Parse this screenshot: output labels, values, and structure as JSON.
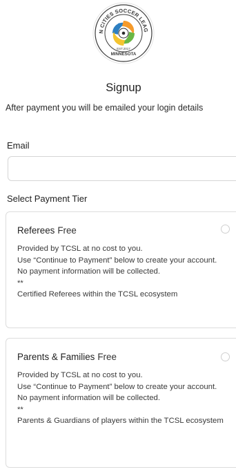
{
  "logo": {
    "arc_text": "TWIN CITIES SOCCER LEAGUES",
    "est": "EST.2017",
    "state": "MINNESOTA",
    "colors": {
      "ring": "#f2f2f2",
      "orange": "#f59a2b",
      "blue": "#2e7fc1",
      "green": "#6ab744",
      "yellow": "#f4c430"
    }
  },
  "form": {
    "title": "Signup",
    "subtitle": "After payment you will be emailed your login details",
    "email_label": "Email",
    "email_value": "",
    "email_placeholder": "",
    "tier_label": "Select Payment Tier"
  },
  "tiers": [
    {
      "name": "Referees",
      "price": "Free",
      "lines": [
        "Provided by TCSL at no cost to you.",
        "Use “Continue to Payment” below to create your account.",
        "No payment information will be collected.",
        "**",
        "Certified Referees within the TCSL ecosystem"
      ],
      "selected": false
    },
    {
      "name": "Parents & Families",
      "price": "Free",
      "lines": [
        "Provided by TCSL at no cost to you.",
        "Use “Continue to Payment” below to create your account.",
        "No payment information will be collected.",
        "**",
        "Parents & Guardians of players within the TCSL ecosystem"
      ],
      "selected": false
    }
  ]
}
